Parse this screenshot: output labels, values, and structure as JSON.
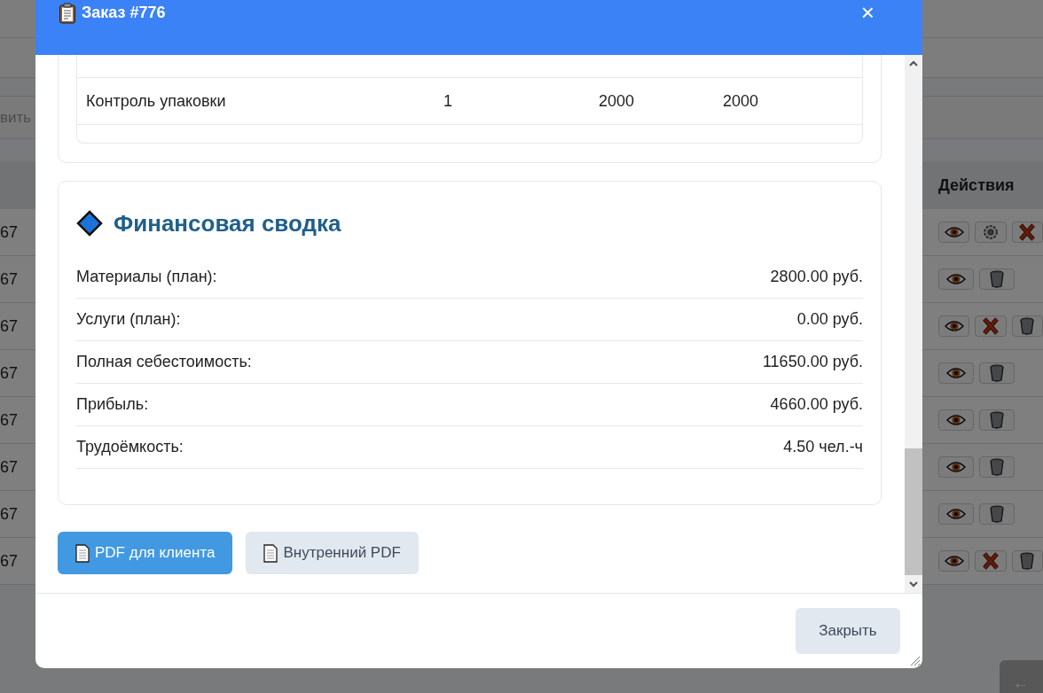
{
  "background_page": {
    "toolbar_text": "вить",
    "table": {
      "actions_header": "Действия",
      "rows": [
        {
          "cell": "67",
          "actions": [
            {
              "kind": "view"
            },
            {
              "kind": "settings"
            },
            {
              "kind": "cancel"
            }
          ]
        },
        {
          "cell": "67",
          "actions": [
            {
              "kind": "view"
            },
            {
              "kind": "delete"
            }
          ]
        },
        {
          "cell": "67",
          "actions": [
            {
              "kind": "view"
            },
            {
              "kind": "cancel"
            },
            {
              "kind": "delete"
            }
          ]
        },
        {
          "cell": "67",
          "actions": [
            {
              "kind": "view"
            },
            {
              "kind": "delete"
            }
          ]
        },
        {
          "cell": "67",
          "actions": [
            {
              "kind": "view"
            },
            {
              "kind": "delete"
            }
          ]
        },
        {
          "cell": "67",
          "actions": [
            {
              "kind": "view"
            },
            {
              "kind": "delete"
            }
          ]
        },
        {
          "cell": "67",
          "actions": [
            {
              "kind": "view"
            },
            {
              "kind": "delete"
            }
          ]
        },
        {
          "cell": "67",
          "actions": [
            {
              "kind": "view"
            },
            {
              "kind": "cancel"
            },
            {
              "kind": "delete"
            }
          ]
        }
      ]
    },
    "back_button": "←"
  },
  "modal": {
    "title": "Заказ #776",
    "close": "×",
    "services_table": {
      "rows": [
        {
          "name": "Контроль упаковки",
          "qty": "1",
          "price": "2000",
          "sum": "2000"
        }
      ]
    },
    "finance": {
      "title": "Финансовая сводка",
      "rows": [
        {
          "label": "Материалы (план):",
          "value": "2800.00 руб."
        },
        {
          "label": "Услуги (план):",
          "value": "0.00 руб."
        },
        {
          "label": "Полная себестоимость:",
          "value": "11650.00 руб."
        },
        {
          "label": "Прибыль:",
          "value": "4660.00 руб."
        },
        {
          "label": "Трудоёмкость:",
          "value": "4.50 чел.-ч"
        }
      ]
    },
    "buttons": [
      {
        "label": "PDF для клиента",
        "kind": "primary"
      },
      {
        "label": "Внутренний PDF",
        "kind": "secondary"
      }
    ],
    "footer_button": "Закрыть"
  }
}
